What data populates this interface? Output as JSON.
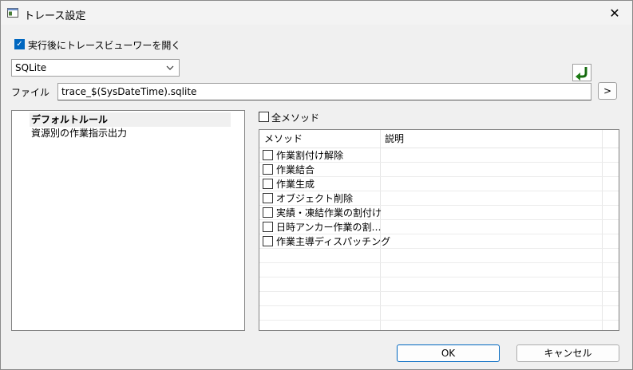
{
  "window": {
    "title": "トレース設定",
    "close_glyph": "✕"
  },
  "options": {
    "open_viewer_label": "実行後にトレースビューワーを開く",
    "open_viewer_checked": true
  },
  "format": {
    "selected": "SQLite"
  },
  "file": {
    "label": "ファイル",
    "value": "trace_$(SysDateTime).sqlite",
    "browse_label": ">"
  },
  "tree": {
    "items": [
      "デフォルトルール",
      "資源別の作業指示出力"
    ]
  },
  "methods": {
    "all_label": "全メソッド",
    "columns": [
      "メソッド",
      "説明"
    ],
    "rows": [
      "作業割付け解除",
      "作業結合",
      "作業生成",
      "オブジェクト削除",
      "実績・凍結作業の割付け",
      "日時アンカー作業の割…",
      "作業主導ディスパッチング"
    ]
  },
  "buttons": {
    "ok": "OK",
    "cancel": "キャンセル"
  },
  "colors": {
    "accent": "#0067c0",
    "redo_icon": "#1e7d16"
  },
  "icons": [
    "app-icon",
    "close-icon",
    "chevron-down-icon",
    "redo-arrow-icon"
  ]
}
